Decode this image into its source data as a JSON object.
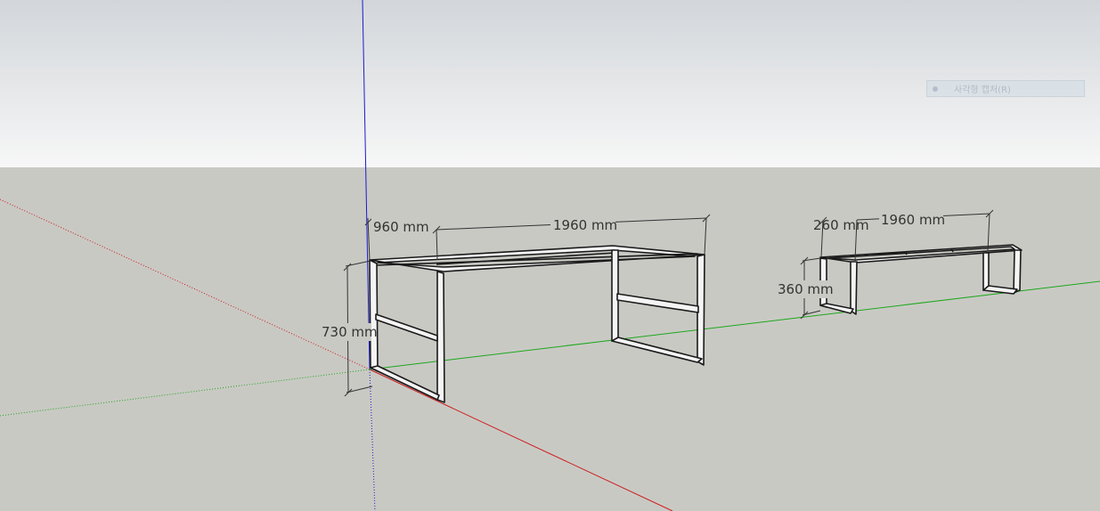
{
  "colors": {
    "sky_top": "#d2d6da",
    "sky_bottom": "#f7f7f7",
    "ground": "#c9c9c4",
    "axis_red": "#cc1b1b",
    "axis_green": "#1ca81c",
    "axis_blue": "#1c1ccc",
    "dimension_line": "#333333",
    "frame_edge": "#1a1a1a",
    "frame_face": "#f4f4f4"
  },
  "toolbar_tooltip": {
    "icon": "select-icon",
    "label": "사각형 캡처(R)"
  },
  "model": {
    "table_frame": {
      "dimensions": {
        "depth": "960 mm",
        "length": "1960 mm",
        "height": "730 mm"
      }
    },
    "bench_frame": {
      "dimensions": {
        "depth": "260 mm",
        "length": "1960 mm",
        "height": "360 mm"
      }
    }
  }
}
